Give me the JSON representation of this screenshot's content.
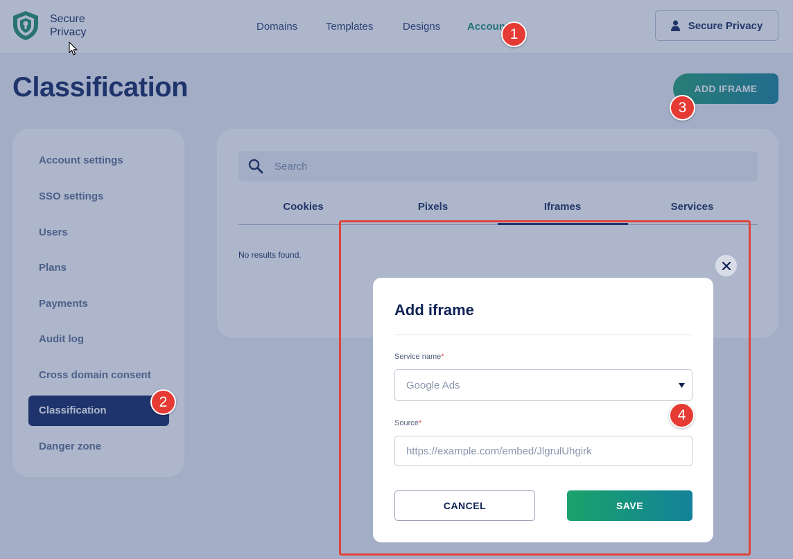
{
  "brand": {
    "name_line1": "Secure",
    "name_line2": "Privacy"
  },
  "nav": {
    "items": [
      "Domains",
      "Templates",
      "Designs",
      "Account"
    ],
    "active": "Account"
  },
  "user_menu": {
    "label": "Secure Privacy"
  },
  "page": {
    "title": "Classification",
    "add_button": "ADD IFRAME"
  },
  "sidebar": {
    "items": [
      "Account settings",
      "SSO settings",
      "Users",
      "Plans",
      "Payments",
      "Audit log",
      "Cross domain consent",
      "Classification",
      "Danger zone"
    ],
    "active": "Classification"
  },
  "content": {
    "search_placeholder": "Search",
    "tabs": [
      "Cookies",
      "Pixels",
      "Iframes",
      "Services"
    ],
    "active_tab": "Iframes",
    "empty_message": "No results found."
  },
  "modal": {
    "title": "Add iframe",
    "service_label": "Service name",
    "service_value": "Google Ads",
    "source_label": "Source",
    "source_placeholder": "https://example.com/embed/JlgrulUhgirk",
    "required_mark": "*",
    "cancel_label": "CANCEL",
    "save_label": "SAVE"
  },
  "annotations": [
    "1",
    "2",
    "3",
    "4"
  ],
  "colors": {
    "accent": "#178a72",
    "navy": "#0b1f5c",
    "annotation_red": "#e53b34",
    "gradient_start": "#1aa26a",
    "gradient_end": "#13829a"
  }
}
